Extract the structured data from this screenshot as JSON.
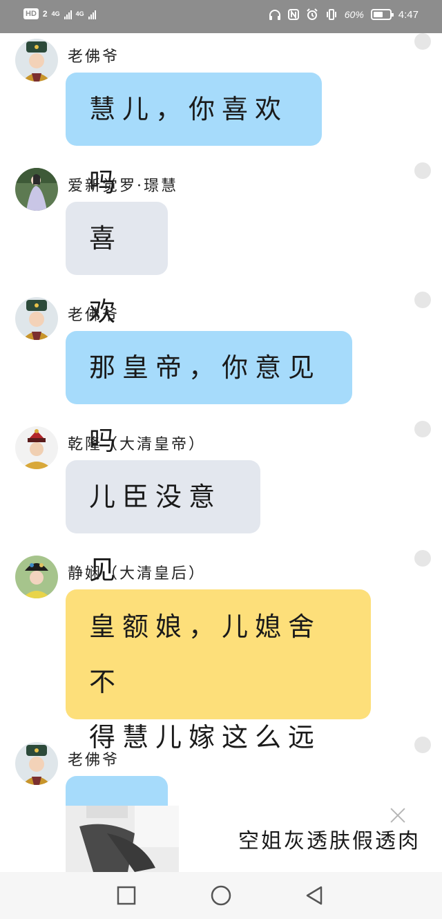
{
  "status_bar": {
    "hd_badge": "HD",
    "sim1": "2",
    "network1": "4G",
    "network2": "4G",
    "battery_percent": "60%",
    "battery_level": 0.6,
    "time": "4:47"
  },
  "messages": [
    {
      "sender": "老佛爷",
      "text": "慧儿，你喜欢吗",
      "bubble_color": "#a6dbfb"
    },
    {
      "sender": "爱新觉罗·璟慧",
      "text": "喜欢",
      "bubble_color": "#e3e7ee"
    },
    {
      "sender": "老佛爷",
      "text": "那皇帝，你意见吗",
      "bubble_color": "#a6dbfb"
    },
    {
      "sender": "乾隆（大清皇帝）",
      "text": "儿臣没意见",
      "bubble_color": "#e3e7ee"
    },
    {
      "sender": "静娴（大清皇后）",
      "text_line1": "皇额娘，儿媳舍不",
      "text_line2": "得慧儿嫁这么远",
      "bubble_color": "#fddf7a"
    },
    {
      "sender": "老佛爷",
      "text": "",
      "bubble_color": "#a6dbfb"
    }
  ],
  "ad": {
    "title": "空姐灰透肤假透肉",
    "image_label": "stockings-photo",
    "close_icon": "close-icon"
  },
  "nav_bar": {
    "recents_icon": "square-recents-icon",
    "home_icon": "circle-home-icon",
    "back_icon": "triangle-back-icon"
  }
}
